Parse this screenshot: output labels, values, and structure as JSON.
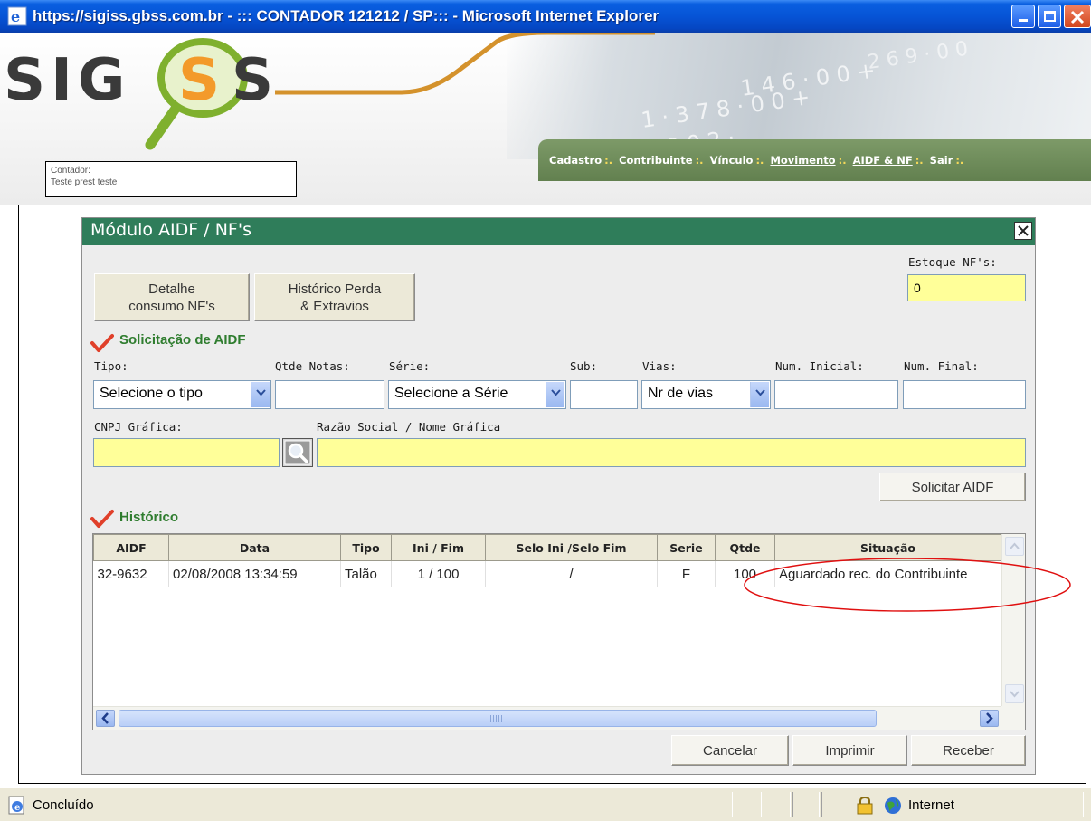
{
  "window": {
    "title": "https://sigiss.gbss.com.br - ::: CONTADOR 121212 / SP::: - Microsoft Internet Explorer"
  },
  "header": {
    "logo_text": "SIGISS",
    "nav": {
      "items": [
        "Cadastro",
        "Contribuinte",
        "Vínculo",
        "Movimento",
        "AIDF & NF",
        "Sair"
      ],
      "separator": ":."
    },
    "contador": {
      "label": "Contador:",
      "value": "Teste prest teste"
    }
  },
  "modal": {
    "title": "Módulo AIDF / NF's",
    "estoque_label": "Estoque NF's:",
    "estoque_value": "0",
    "buttons": {
      "detalhe_line1": "Detalhe",
      "detalhe_line2": "consumo NF's",
      "historico_line1": "Histórico Perda",
      "historico_line2": "& Extravios",
      "solicitar": "Solicitar AIDF",
      "cancelar": "Cancelar",
      "imprimir": "Imprimir",
      "receber": "Receber"
    },
    "solicitacao": {
      "heading": "Solicitação de AIDF",
      "tipo_label": "Tipo:",
      "tipo_value": "Selecione o tipo",
      "qtde_label": "Qtde Notas:",
      "serie_label": "Série:",
      "serie_value": "Selecione a Série",
      "sub_label": "Sub:",
      "vias_label": "Vias:",
      "vias_value": "Nr de vias",
      "num_inicial_label": "Num. Inicial:",
      "num_final_label": "Num. Final:",
      "cnpj_label": "CNPJ Gráfica:",
      "razao_label": "Razão Social / Nome Gráfica"
    },
    "historico": {
      "heading": "Histórico",
      "columns": [
        "AIDF",
        "Data",
        "Tipo",
        "Ini / Fim",
        "Selo Ini /Selo Fim",
        "Serie",
        "Qtde",
        "Situação"
      ],
      "rows": [
        [
          "32-9632",
          "02/08/2008 13:34:59",
          "Talão",
          "1 / 100",
          "/",
          "F",
          "100",
          "Aguardado rec. do Contribuinte"
        ]
      ]
    }
  },
  "statusbar": {
    "text": "Concluído",
    "zone": "Internet"
  },
  "colors": {
    "modal_header": "#2f7d5a",
    "nav_bar": "#62804f",
    "highlight_field": "#ffff99",
    "annotation": "#e01010"
  }
}
